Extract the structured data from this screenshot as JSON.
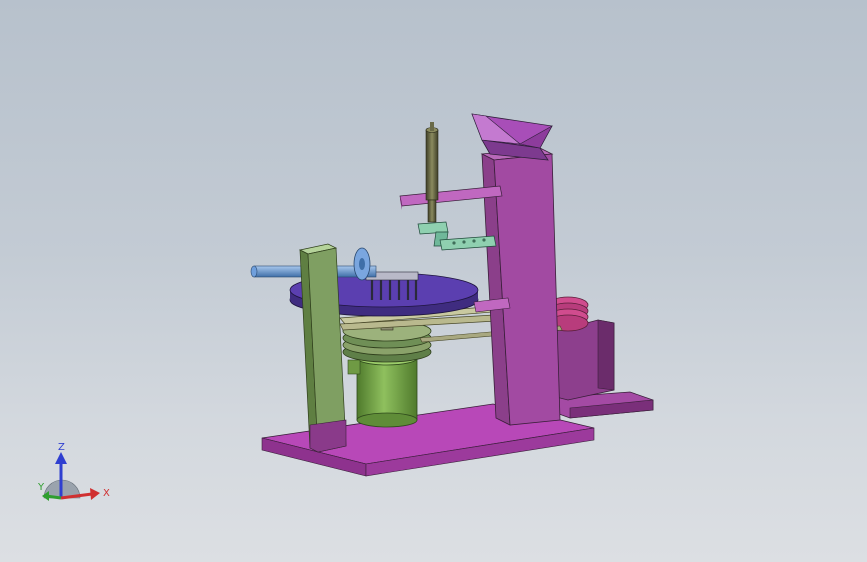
{
  "viewport": {
    "background_top": "#b7c1cc",
    "background_bottom": "#dcdfe3"
  },
  "model": {
    "colors": {
      "base_plate": "#b848b8",
      "column": "#8b3f8a",
      "left_post": "#7f9f62",
      "turntable": "#5b3fb0",
      "motor": "#6f9a44",
      "hopper": "#8d3c9c",
      "rail": "#c9c9a0",
      "spring_pulley": "#d04c8e",
      "shaft": "#5f8fcf",
      "spindle": "#5a5a3a",
      "bracket": "#6fb89a",
      "rear_box": "#8d3f8d"
    }
  },
  "triad": {
    "x_label": "X",
    "y_label": "Y",
    "z_label": "Z",
    "x_color": "#d03030",
    "y_color": "#2f9e2f",
    "z_color": "#2f3fd0"
  }
}
